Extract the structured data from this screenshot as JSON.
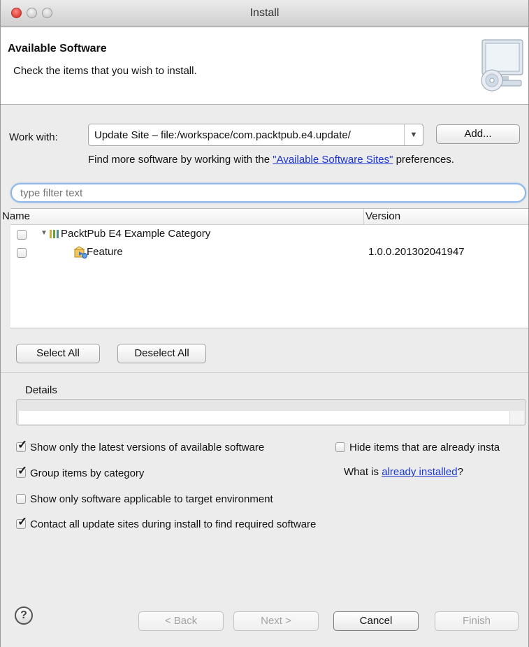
{
  "window": {
    "title": "Install"
  },
  "header": {
    "title": "Available Software",
    "description": "Check the items that you wish to install."
  },
  "work_with": {
    "label": "Work with:",
    "value": "Update Site – file:/workspace/com.packtpub.e4.update/",
    "add_label": "Add...",
    "find_more_prefix": "Find more software by working with the ",
    "find_more_link": "\"Available Software Sites\"",
    "find_more_suffix": " preferences."
  },
  "filter": {
    "placeholder": "type filter text"
  },
  "table": {
    "columns": [
      "Name",
      "Version"
    ],
    "rows": [
      {
        "name": "PacktPub E4 Example Category",
        "version": "",
        "checked": false,
        "expanded": true,
        "icon": "category-icon"
      },
      {
        "name": "Feature",
        "version": "1.0.0.201302041947",
        "checked": false,
        "icon": "feature-icon"
      }
    ]
  },
  "buttons": {
    "select_all": "Select All",
    "deselect_all": "Deselect All",
    "back": "< Back",
    "next": "Next >",
    "cancel": "Cancel",
    "finish": "Finish"
  },
  "details": {
    "label": "Details"
  },
  "options": {
    "show_latest": {
      "label": "Show only the latest versions of available software",
      "checked": true
    },
    "hide_installed": {
      "label": "Hide items that are already insta",
      "checked": false
    },
    "group_by_category": {
      "label": "Group items by category",
      "checked": true
    },
    "what_is_prefix": "What is ",
    "what_is_link": "already installed",
    "what_is_suffix": "?",
    "target_env": {
      "label": "Show only software applicable to target environment",
      "checked": false
    },
    "contact_all": {
      "label": "Contact all update sites during install to find required software",
      "checked": true
    }
  },
  "help": {
    "glyph": "?"
  }
}
